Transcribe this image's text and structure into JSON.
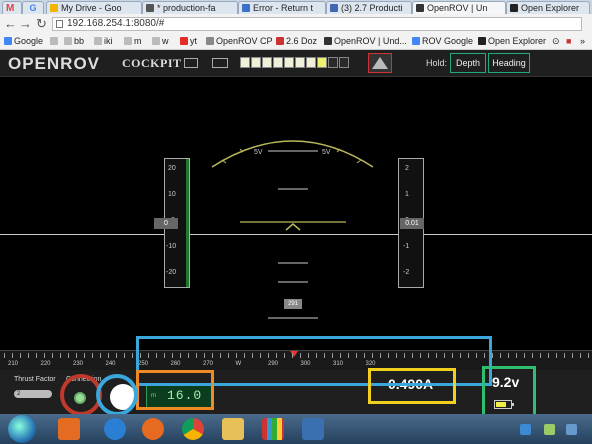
{
  "browser": {
    "tabs": [
      {
        "label": "M"
      },
      {
        "label": "My Drive - Goo"
      },
      {
        "label": "* production-fa"
      },
      {
        "label": "Error - Return t"
      },
      {
        "label": "(3) 2.7 Producti"
      },
      {
        "label": "OpenROV | Un"
      },
      {
        "label": "Open Explorer"
      }
    ],
    "address": "192.168.254.1:8080/#",
    "bookmarks": [
      {
        "label": "Google"
      },
      {
        "label": "bb"
      },
      {
        "label": "iki"
      },
      {
        "label": "m"
      },
      {
        "label": "w"
      },
      {
        "label": "yt"
      },
      {
        "label": "OpenROV CP"
      },
      {
        "label": "2.6 Doz"
      },
      {
        "label": "OpenROV | Und..."
      },
      {
        "label": "ROV Google"
      },
      {
        "label": "Open Explorer"
      }
    ]
  },
  "cockpit": {
    "brand": "OPENROV",
    "title": "COCKPIT",
    "hold_label": "Hold:",
    "hold_buttons": [
      {
        "label": "Depth"
      },
      {
        "label": "Heading"
      }
    ],
    "battery_level_segments": 10,
    "battery_lit_segments": 8
  },
  "hud": {
    "pitch_tape_labels": [
      "20",
      "10",
      "0",
      "-10",
      "-20"
    ],
    "pitch_readout": "0",
    "depth_tape_labels": [
      "2",
      "1",
      "0",
      "-1",
      "-2"
    ],
    "depth_readout": "0.01",
    "heading_box": "291",
    "arc_labels": [
      "5V",
      "5V"
    ]
  },
  "compass": {
    "labels": [
      "210",
      "220",
      "230",
      "240",
      "250",
      "260",
      "270",
      "W",
      "290",
      "300",
      "310",
      "320"
    ]
  },
  "status": {
    "thrust_label": "Thrust Factor",
    "connection_label": "Connection",
    "thrust_value": "2",
    "depth_unit": "m",
    "depth_value": "16.0",
    "current": "0.490A",
    "voltage": "9.2v"
  },
  "colors": {
    "overlay_red": "#c0392b",
    "overlay_blue": "#3aa7dc",
    "overlay_orange": "#f08a24",
    "overlay_yellow": "#f2d01e",
    "overlay_green": "#2fbf71",
    "battery_yellow": "#f0f070"
  }
}
